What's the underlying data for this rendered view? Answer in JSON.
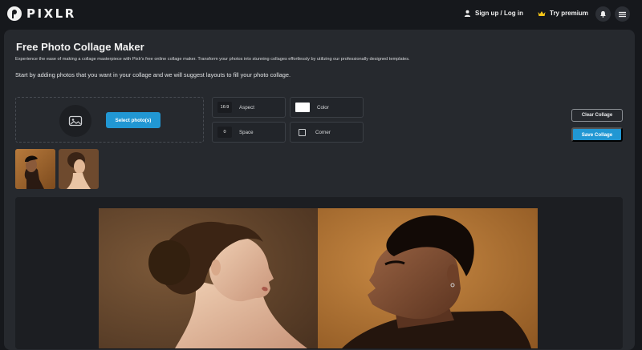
{
  "header": {
    "brand": "PIXLR",
    "signup_label": "Sign up / Log in",
    "premium_label": "Try premium"
  },
  "main": {
    "title": "Free Photo Collage Maker",
    "description": "Experience the ease of making a collage masterpiece with Pixlr's free online collage maker. Transform your photos into stunning collages effortlessly by utilizing our professionally designed templates.",
    "hint": "Start by adding photos that you want in your collage and we will suggest layouts to fill your photo collage."
  },
  "upload": {
    "select_label": "Select photo(s)"
  },
  "options": {
    "aspect_value": "16:9",
    "aspect_label": "Aspect",
    "color_label": "Color",
    "color_value": "#ffffff",
    "space_value": "0",
    "space_label": "Space",
    "corner_label": "Corner"
  },
  "actions": {
    "clear_label": "Clear Collage",
    "save_label": "Save Collage"
  },
  "colors": {
    "accent": "#2197d3",
    "background": "#16181c",
    "panel": "#26292e"
  }
}
